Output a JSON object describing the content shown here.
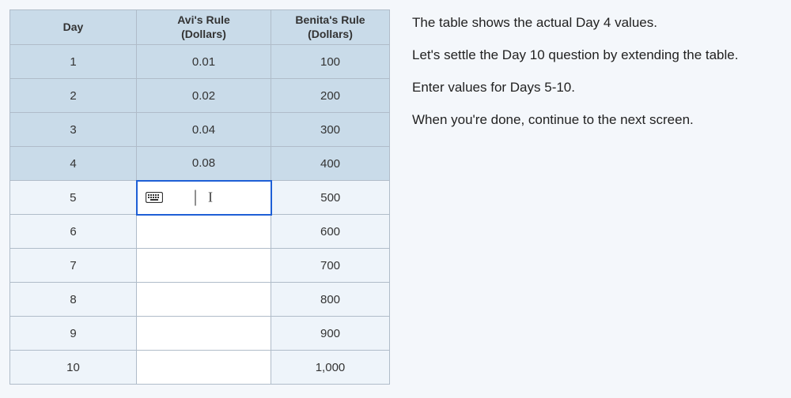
{
  "table": {
    "headers": {
      "day": "Day",
      "avi": "Avi's Rule\n(Dollars)",
      "benita": "Benita's Rule\n(Dollars)"
    },
    "rows": [
      {
        "day": "1",
        "avi": "0.01",
        "benita": "100",
        "locked": true
      },
      {
        "day": "2",
        "avi": "0.02",
        "benita": "200",
        "locked": true
      },
      {
        "day": "3",
        "avi": "0.04",
        "benita": "300",
        "locked": true
      },
      {
        "day": "4",
        "avi": "0.08",
        "benita": "400",
        "locked": true
      },
      {
        "day": "5",
        "avi": "",
        "benita": "500",
        "locked": false,
        "active": true
      },
      {
        "day": "6",
        "avi": "",
        "benita": "600",
        "locked": false
      },
      {
        "day": "7",
        "avi": "",
        "benita": "700",
        "locked": false
      },
      {
        "day": "8",
        "avi": "",
        "benita": "800",
        "locked": false
      },
      {
        "day": "9",
        "avi": "",
        "benita": "900",
        "locked": false
      },
      {
        "day": "10",
        "avi": "",
        "benita": "1,000",
        "locked": false
      }
    ]
  },
  "instructions": {
    "p1": "The table shows the actual Day 4 values.",
    "p2": "Let's settle the Day 10 question by extending the table.",
    "p3": "Enter values for Days 5-10.",
    "p4": "When you're done, continue to the next screen."
  },
  "icons": {
    "keyboard": "keyboard-icon"
  }
}
